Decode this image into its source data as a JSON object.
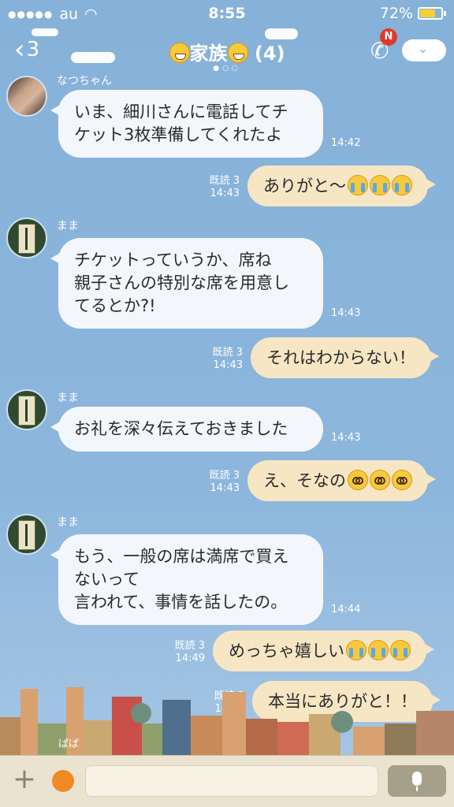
{
  "status": {
    "carrier": "au",
    "time": "8:55",
    "battery": "72%",
    "battery_level": 0.72
  },
  "header": {
    "back_count": "3",
    "title": "家族",
    "member_count": "(4)",
    "call_badge": "N"
  },
  "messages": [
    {
      "sender": "なつちゃん",
      "text": [
        "いま、細川さんに電話してチ",
        "ケット3枚準備してくれたよ"
      ],
      "time": "14:42"
    },
    {
      "read": "既読 3",
      "time": "14:43",
      "text": "ありがと〜",
      "emoji": "cry",
      "emoji_count": 3
    },
    {
      "sender": "まま",
      "text": [
        "チケットっていうか、席ね",
        "親子さんの特別な席を用意し",
        "てるとか?!"
      ],
      "time": "14:43"
    },
    {
      "read": "既読 3",
      "time": "14:43",
      "text": "それはわからない！"
    },
    {
      "sender": "まま",
      "text": [
        "お礼を深々伝えておきました"
      ],
      "time": "14:43"
    },
    {
      "read": "既読 3",
      "time": "14:43",
      "text": "え、そなの",
      "emoji": "flushed",
      "emoji_count": 3
    },
    {
      "sender": "まま",
      "text": [
        "もう、一般の席は満席で買え",
        "ないって",
        "言われて、事情を話したの。"
      ],
      "time": "14:44"
    },
    {
      "read": "既読 3",
      "time": "14:49",
      "text": "めっちゃ嬉しい",
      "emoji": "cry",
      "emoji_count": 3
    },
    {
      "read": "既読 3",
      "time": "14:49",
      "text": "本当にありがと！！"
    }
  ],
  "footer_sender": "ぱぱ",
  "input": {
    "placeholder": ""
  },
  "icons": {
    "back": "chevron-left-icon",
    "call": "phone-icon",
    "menu": "chevron-down-icon",
    "add": "plus-icon",
    "sticker": "sticker-icon",
    "voice": "microphone-icon"
  }
}
